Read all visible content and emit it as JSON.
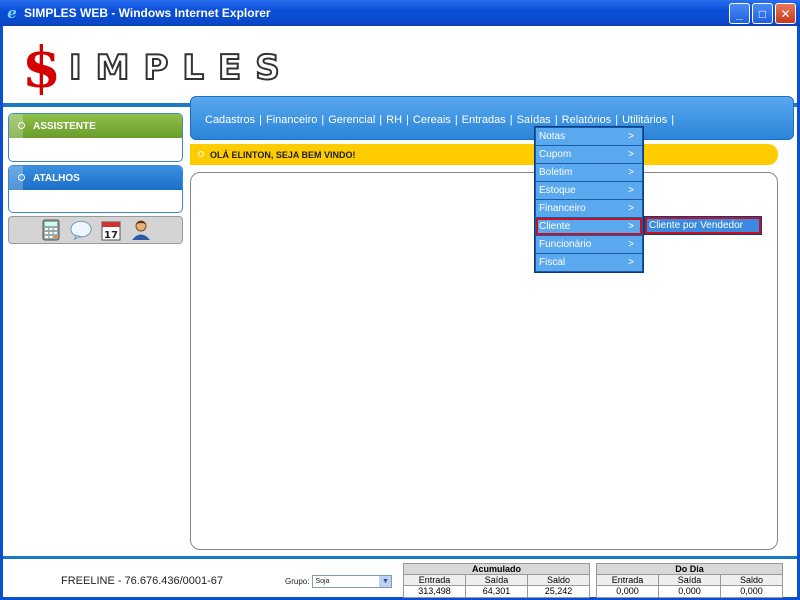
{
  "window": {
    "title": "SIMPLES WEB - Windows Internet Explorer",
    "minimize": "_",
    "maximize": "□",
    "close": "✕"
  },
  "logo": {
    "first": "$",
    "rest": "IMPLES"
  },
  "sidebar": {
    "assistente": "ASSISTENTE",
    "atalhos": "ATALHOS",
    "tools": [
      "calculator-icon",
      "chat-bubble-icon",
      "calendar-icon",
      "user-icon"
    ],
    "calendar_day": "17"
  },
  "nav": {
    "items": [
      "Cadastros",
      "|",
      "Financeiro",
      "|",
      "Gerencial",
      "|",
      "RH",
      "|",
      "Cereais",
      "|",
      "Entradas",
      "|",
      "Saídas",
      "|",
      "Relatórios",
      "|",
      "Utilitários",
      "|"
    ]
  },
  "welcome": "OLÁ ELINTON, SEJA BEM VINDO!",
  "menu": {
    "items": [
      {
        "label": "Notas",
        "arrow": ">"
      },
      {
        "label": "Cupom",
        "arrow": ">"
      },
      {
        "label": "Boletim",
        "arrow": ">"
      },
      {
        "label": "Estoque",
        "arrow": ">"
      },
      {
        "label": "Financeiro",
        "arrow": ">"
      },
      {
        "label": "Cliente",
        "arrow": ">"
      },
      {
        "label": "Funcionário",
        "arrow": ">"
      },
      {
        "label": "Fiscal",
        "arrow": ">"
      }
    ],
    "submenu": "Cliente por Vendedor"
  },
  "footer": {
    "company": "FREELINE - 76.676.436/0001-67",
    "grupo_label": "Grupo:",
    "grupo_value": "Soja",
    "acumulado": {
      "title": "Acumulado",
      "labels": [
        "Entrada",
        "Saída",
        "Saldo"
      ],
      "values": [
        "313,498",
        "64,301",
        "25,242"
      ]
    },
    "dodia": {
      "title": "Do Dia",
      "labels": [
        "Entrada",
        "Saída",
        "Saldo"
      ],
      "values": [
        "0,000",
        "0,000",
        "0,000"
      ]
    }
  },
  "colors": {
    "accent": "#2a84d8",
    "assist": "#6a9d2c",
    "welcome": "#ffcc00",
    "logo_dollar": "#d40000",
    "active_outline": "#cc1020"
  }
}
